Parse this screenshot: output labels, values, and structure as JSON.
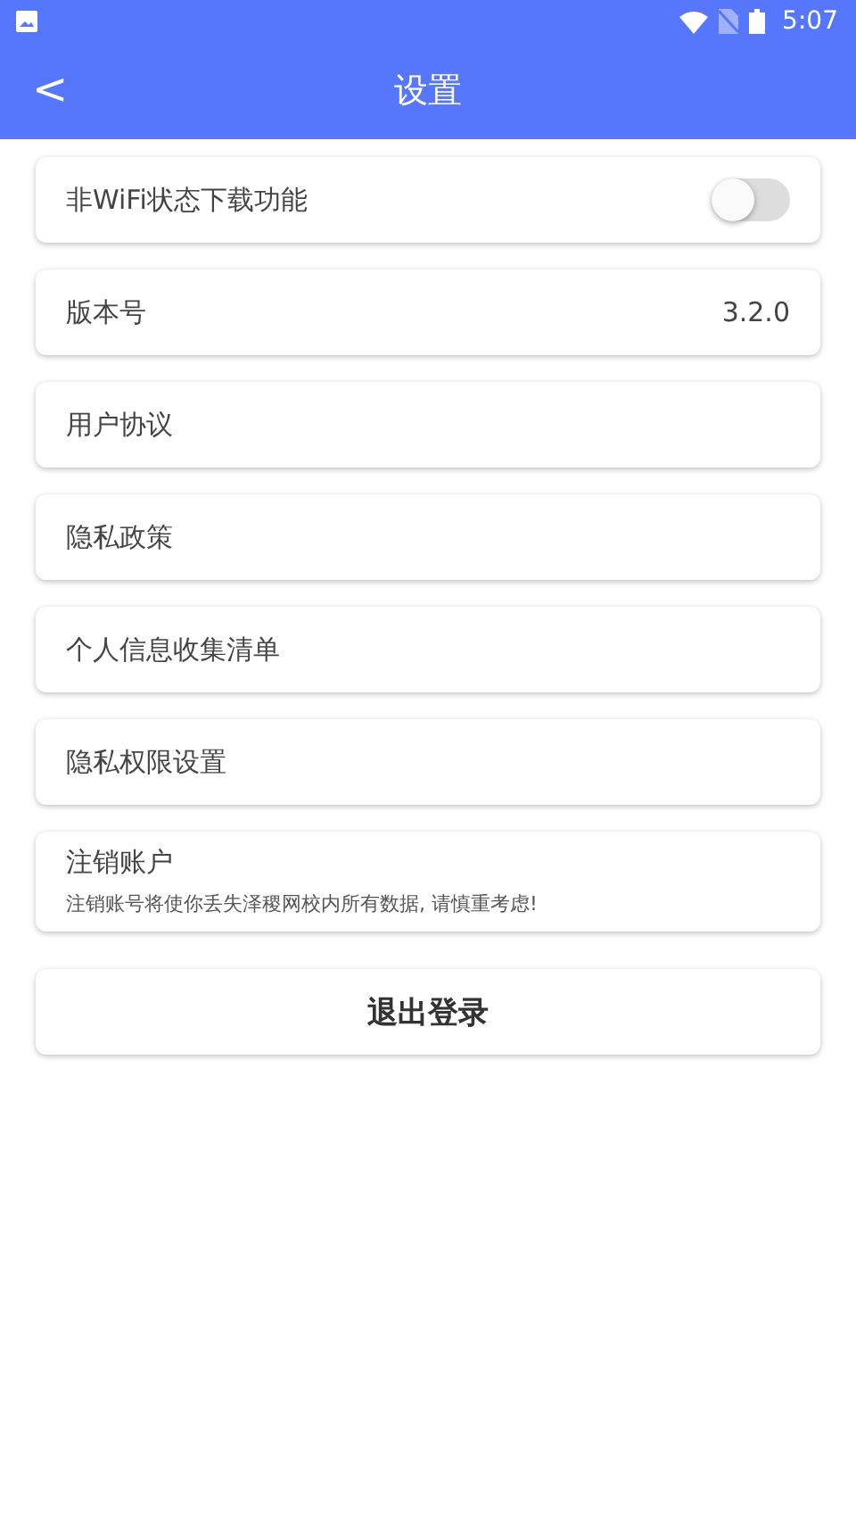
{
  "status_bar": {
    "time": "5:07"
  },
  "header": {
    "back": "<",
    "title": "设置"
  },
  "rows": [
    {
      "kind": "toggle",
      "label": "非WiFi状态下载功能",
      "on": false
    },
    {
      "kind": "value",
      "label": "版本号",
      "value": "3.2.0"
    },
    {
      "kind": "link",
      "label": "用户协议"
    },
    {
      "kind": "link",
      "label": "隐私政策"
    },
    {
      "kind": "link",
      "label": "个人信息收集清单"
    },
    {
      "kind": "link",
      "label": "隐私权限设置"
    },
    {
      "kind": "warning",
      "label": "注销账户",
      "note": "注销账号将使你丢失泽稷网校内所有数据, 请慎重考虑!"
    }
  ],
  "logout_button": "退出登录"
}
